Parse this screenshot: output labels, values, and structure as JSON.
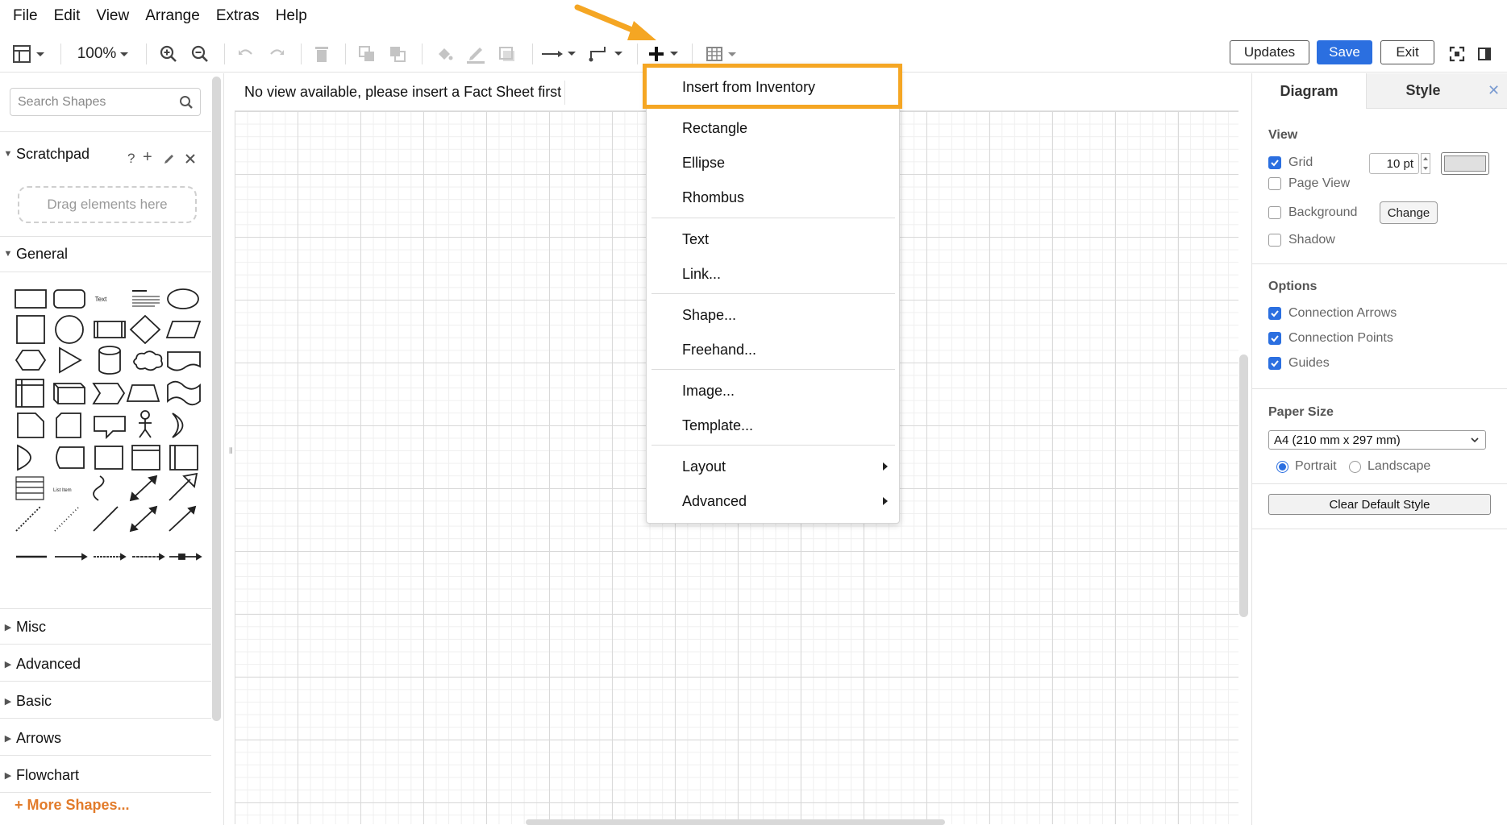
{
  "menubar": {
    "items": [
      "File",
      "Edit",
      "View",
      "Arrange",
      "Extras",
      "Help"
    ]
  },
  "toolbar": {
    "zoom": "100%",
    "updates_label": "Updates",
    "save_label": "Save",
    "exit_label": "Exit"
  },
  "sidebar": {
    "search_placeholder": "Search Shapes",
    "scratchpad": {
      "title": "Scratchpad",
      "help": "?",
      "drag_hint": "Drag elements here"
    },
    "general_title": "General",
    "sections": [
      "Misc",
      "Advanced",
      "Basic",
      "Arrows",
      "Flowchart"
    ],
    "more_shapes": "More Shapes..."
  },
  "canvas": {
    "notice": "No view available, please insert a Fact Sheet first"
  },
  "insert_menu": {
    "items": [
      "Insert from Inventory",
      "Rectangle",
      "Ellipse",
      "Rhombus",
      "Text",
      "Link...",
      "Shape...",
      "Freehand...",
      "Image...",
      "Template...",
      "Layout",
      "Advanced"
    ]
  },
  "format_panel": {
    "tabs": [
      "Diagram",
      "Style"
    ],
    "view": {
      "title": "View",
      "grid": {
        "label": "Grid",
        "checked": true,
        "size": "10 pt"
      },
      "page_view": {
        "label": "Page View",
        "checked": false
      },
      "background": {
        "label": "Background",
        "checked": false,
        "button": "Change"
      },
      "shadow": {
        "label": "Shadow",
        "checked": false
      }
    },
    "options": {
      "title": "Options",
      "connection_arrows": {
        "label": "Connection Arrows",
        "checked": true
      },
      "connection_points": {
        "label": "Connection Points",
        "checked": true
      },
      "guides": {
        "label": "Guides",
        "checked": true
      }
    },
    "paper": {
      "title": "Paper Size",
      "selected": "A4 (210 mm x 297 mm)",
      "portrait": "Portrait",
      "landscape": "Landscape",
      "orientation": "portrait"
    },
    "clear_default_style": "Clear Default Style"
  },
  "colors": {
    "accent": "#2b6fe0",
    "highlight": "#f5a623",
    "more_shapes": "#e27b2a"
  }
}
